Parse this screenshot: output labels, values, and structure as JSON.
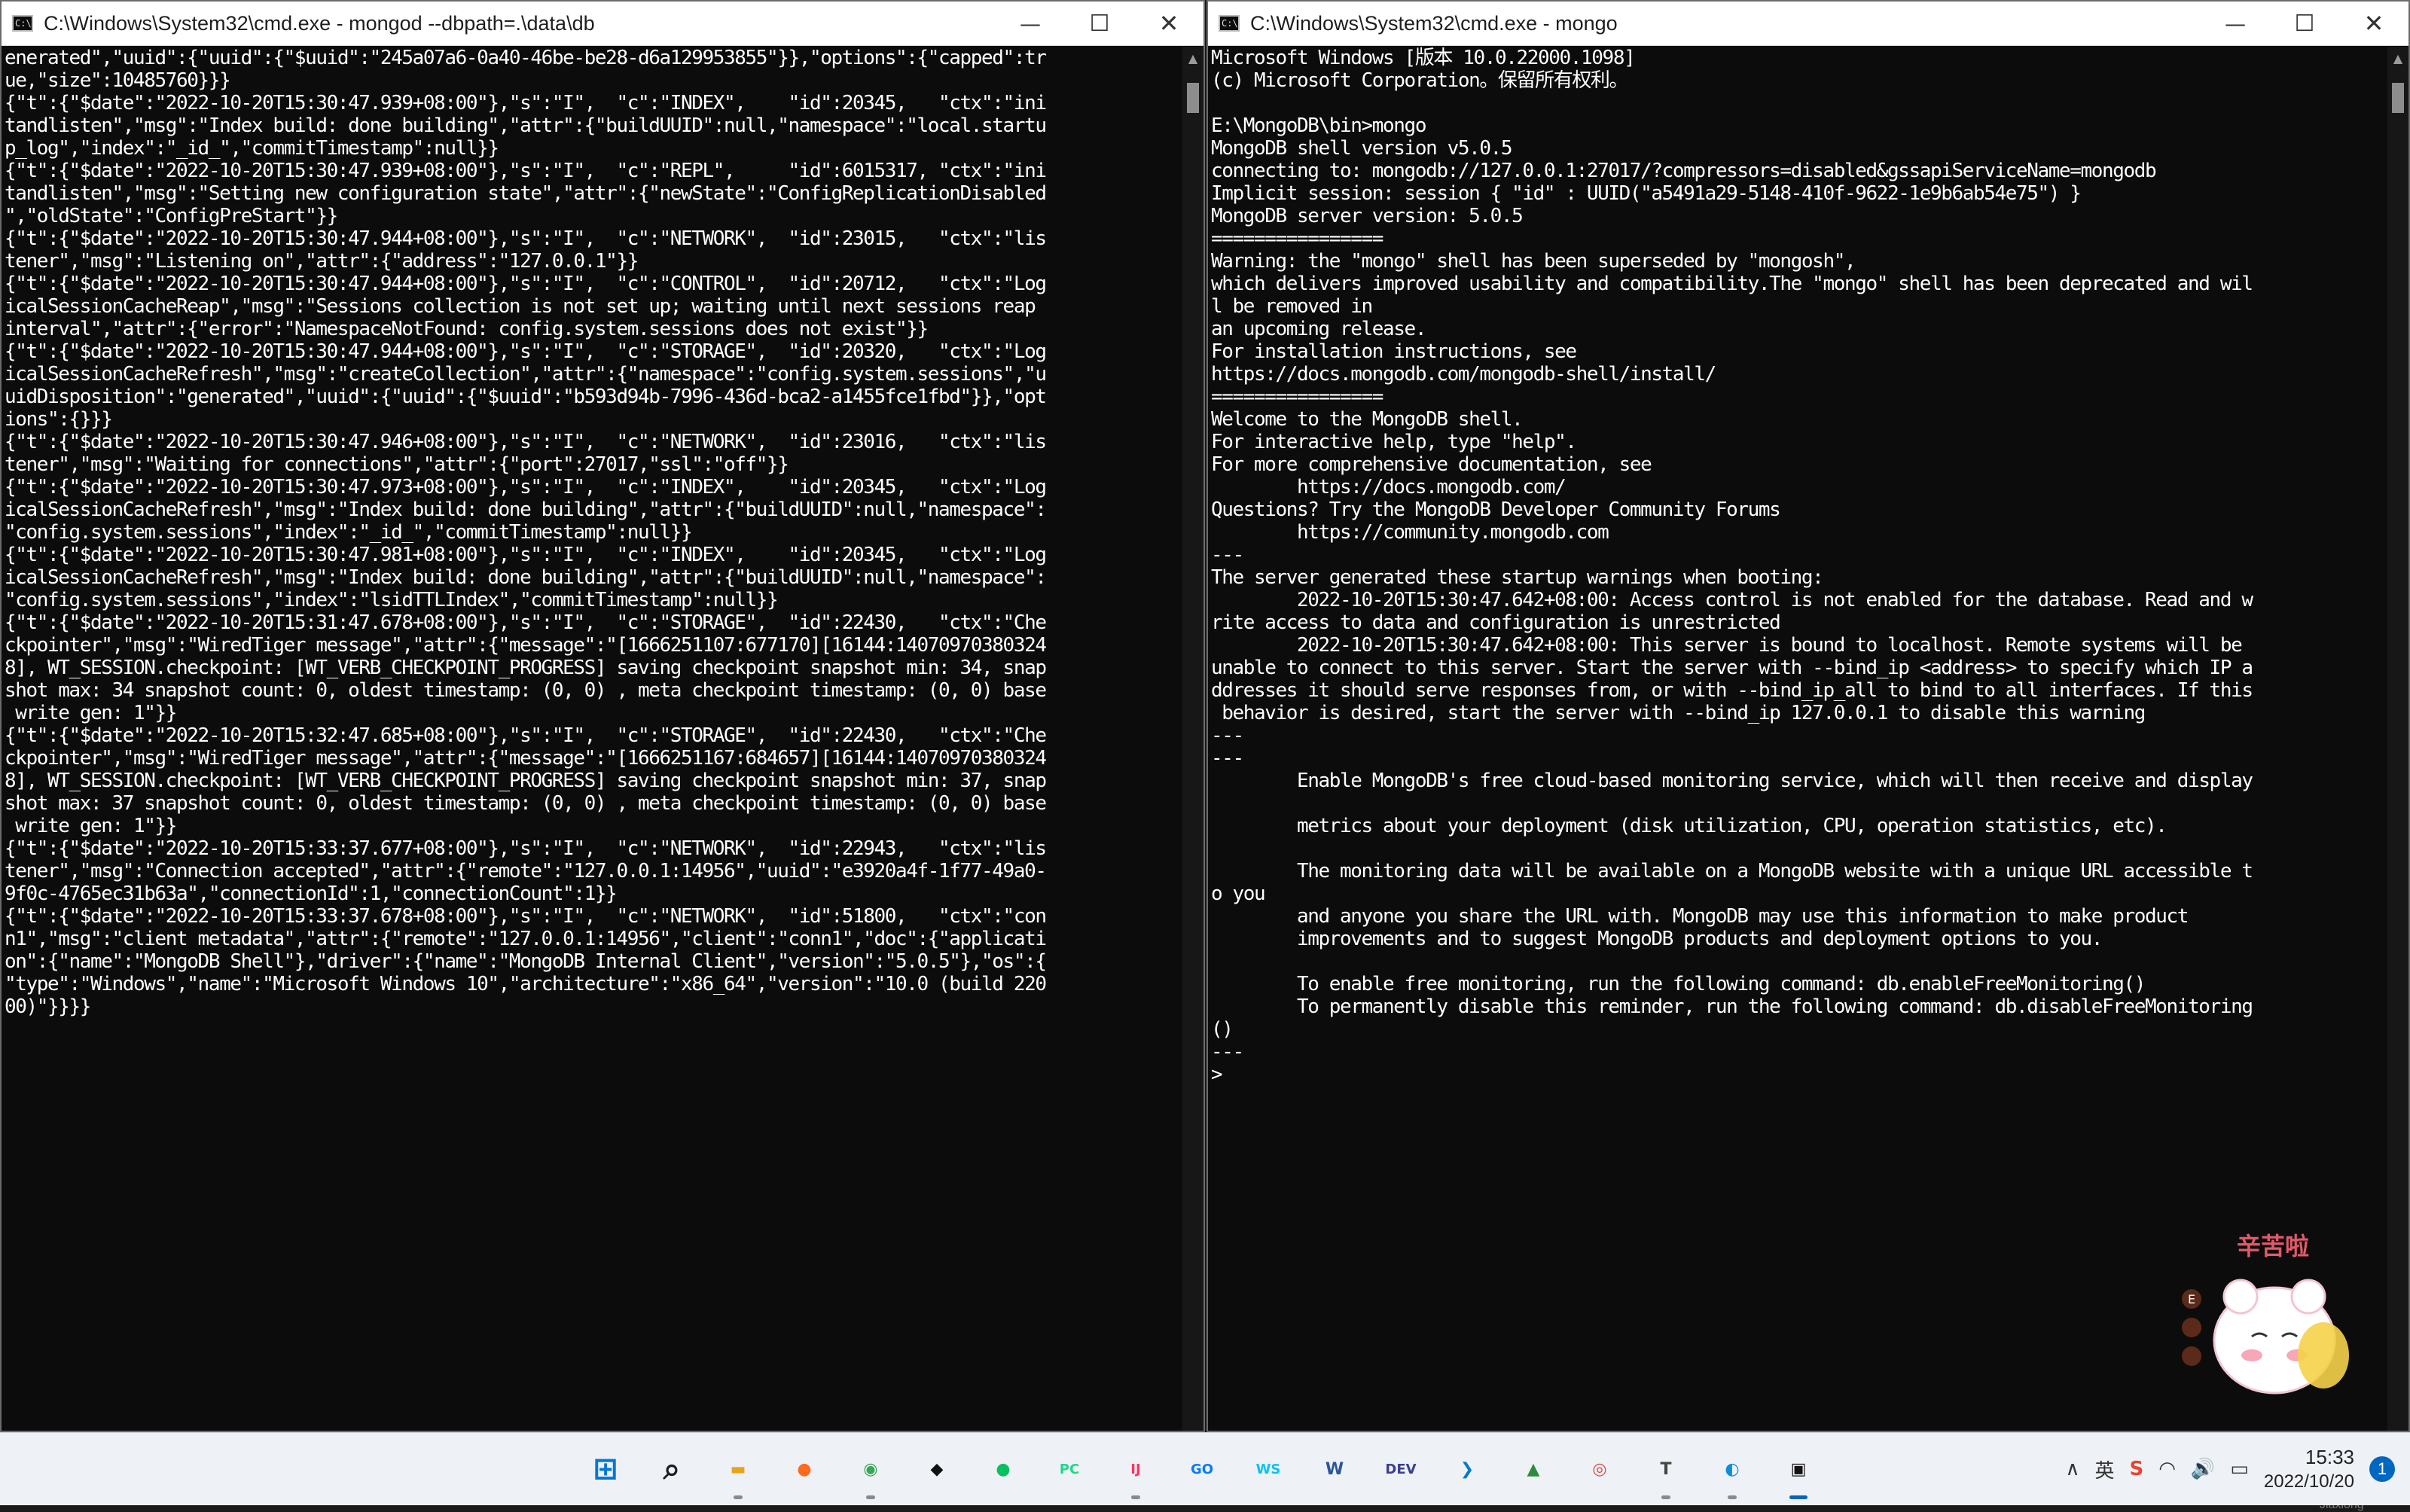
{
  "left_window": {
    "title": "C:\\Windows\\System32\\cmd.exe - mongod  --dbpath=.\\data\\db",
    "icon": "cmd-icon",
    "output": "enerated\",\"uuid\":{\"uuid\":{\"$uuid\":\"245a07a6-0a40-46be-be28-d6a129953855\"}},\"options\":{\"capped\":tr\nue,\"size\":10485760}}}\n{\"t\":{\"$date\":\"2022-10-20T15:30:47.939+08:00\"},\"s\":\"I\",  \"c\":\"INDEX\",    \"id\":20345,   \"ctx\":\"ini\ntandlisten\",\"msg\":\"Index build: done building\",\"attr\":{\"buildUUID\":null,\"namespace\":\"local.startu\np_log\",\"index\":\"_id_\",\"commitTimestamp\":null}}\n{\"t\":{\"$date\":\"2022-10-20T15:30:47.939+08:00\"},\"s\":\"I\",  \"c\":\"REPL\",     \"id\":6015317, \"ctx\":\"ini\ntandlisten\",\"msg\":\"Setting new configuration state\",\"attr\":{\"newState\":\"ConfigReplicationDisabled\n\",\"oldState\":\"ConfigPreStart\"}}\n{\"t\":{\"$date\":\"2022-10-20T15:30:47.944+08:00\"},\"s\":\"I\",  \"c\":\"NETWORK\",  \"id\":23015,   \"ctx\":\"lis\ntener\",\"msg\":\"Listening on\",\"attr\":{\"address\":\"127.0.0.1\"}}\n{\"t\":{\"$date\":\"2022-10-20T15:30:47.944+08:00\"},\"s\":\"I\",  \"c\":\"CONTROL\",  \"id\":20712,   \"ctx\":\"Log\nicalSessionCacheReap\",\"msg\":\"Sessions collection is not set up; waiting until next sessions reap\ninterval\",\"attr\":{\"error\":\"NamespaceNotFound: config.system.sessions does not exist\"}}\n{\"t\":{\"$date\":\"2022-10-20T15:30:47.944+08:00\"},\"s\":\"I\",  \"c\":\"STORAGE\",  \"id\":20320,   \"ctx\":\"Log\nicalSessionCacheRefresh\",\"msg\":\"createCollection\",\"attr\":{\"namespace\":\"config.system.sessions\",\"u\nuidDisposition\":\"generated\",\"uuid\":{\"uuid\":{\"$uuid\":\"b593d94b-7996-436d-bca2-a1455fce1fbd\"}},\"opt\nions\":{}}}\n{\"t\":{\"$date\":\"2022-10-20T15:30:47.946+08:00\"},\"s\":\"I\",  \"c\":\"NETWORK\",  \"id\":23016,   \"ctx\":\"lis\ntener\",\"msg\":\"Waiting for connections\",\"attr\":{\"port\":27017,\"ssl\":\"off\"}}\n{\"t\":{\"$date\":\"2022-10-20T15:30:47.973+08:00\"},\"s\":\"I\",  \"c\":\"INDEX\",    \"id\":20345,   \"ctx\":\"Log\nicalSessionCacheRefresh\",\"msg\":\"Index build: done building\",\"attr\":{\"buildUUID\":null,\"namespace\":\n\"config.system.sessions\",\"index\":\"_id_\",\"commitTimestamp\":null}}\n{\"t\":{\"$date\":\"2022-10-20T15:30:47.981+08:00\"},\"s\":\"I\",  \"c\":\"INDEX\",    \"id\":20345,   \"ctx\":\"Log\nicalSessionCacheRefresh\",\"msg\":\"Index build: done building\",\"attr\":{\"buildUUID\":null,\"namespace\":\n\"config.system.sessions\",\"index\":\"lsidTTLIndex\",\"commitTimestamp\":null}}\n{\"t\":{\"$date\":\"2022-10-20T15:31:47.678+08:00\"},\"s\":\"I\",  \"c\":\"STORAGE\",  \"id\":22430,   \"ctx\":\"Che\nckpointer\",\"msg\":\"WiredTiger message\",\"attr\":{\"message\":\"[1666251107:677170][16144:14070970380324\n8], WT_SESSION.checkpoint: [WT_VERB_CHECKPOINT_PROGRESS] saving checkpoint snapshot min: 34, snap\nshot max: 34 snapshot count: 0, oldest timestamp: (0, 0) , meta checkpoint timestamp: (0, 0) base\n write gen: 1\"}}\n{\"t\":{\"$date\":\"2022-10-20T15:32:47.685+08:00\"},\"s\":\"I\",  \"c\":\"STORAGE\",  \"id\":22430,   \"ctx\":\"Che\nckpointer\",\"msg\":\"WiredTiger message\",\"attr\":{\"message\":\"[1666251167:684657][16144:14070970380324\n8], WT_SESSION.checkpoint: [WT_VERB_CHECKPOINT_PROGRESS] saving checkpoint snapshot min: 37, snap\nshot max: 37 snapshot count: 0, oldest timestamp: (0, 0) , meta checkpoint timestamp: (0, 0) base\n write gen: 1\"}}\n{\"t\":{\"$date\":\"2022-10-20T15:33:37.677+08:00\"},\"s\":\"I\",  \"c\":\"NETWORK\",  \"id\":22943,   \"ctx\":\"lis\ntener\",\"msg\":\"Connection accepted\",\"attr\":{\"remote\":\"127.0.0.1:14956\",\"uuid\":\"e3920a4f-1f77-49a0-\n9f0c-4765ec31b63a\",\"connectionId\":1,\"connectionCount\":1}}\n{\"t\":{\"$date\":\"2022-10-20T15:33:37.678+08:00\"},\"s\":\"I\",  \"c\":\"NETWORK\",  \"id\":51800,   \"ctx\":\"con\nn1\",\"msg\":\"client metadata\",\"attr\":{\"remote\":\"127.0.0.1:14956\",\"client\":\"conn1\",\"doc\":{\"applicati\non\":{\"name\":\"MongoDB Shell\"},\"driver\":{\"name\":\"MongoDB Internal Client\",\"version\":\"5.0.5\"},\"os\":{\n\"type\":\"Windows\",\"name\":\"Microsoft Windows 10\",\"architecture\":\"x86_64\",\"version\":\"10.0 (build 220\n00)\"}}}}"
  },
  "right_window": {
    "title": "C:\\Windows\\System32\\cmd.exe - mongo",
    "icon": "cmd-icon",
    "output": "Microsoft Windows [版本 10.0.22000.1098]\n(c) Microsoft Corporation。保留所有权利。\n\nE:\\MongoDB\\bin>mongo\nMongoDB shell version v5.0.5\nconnecting to: mongodb://127.0.0.1:27017/?compressors=disabled&gssapiServiceName=mongodb\nImplicit session: session { \"id\" : UUID(\"a5491a29-5148-410f-9622-1e9b6ab54e75\") }\nMongoDB server version: 5.0.5\n================\nWarning: the \"mongo\" shell has been superseded by \"mongosh\",\nwhich delivers improved usability and compatibility.The \"mongo\" shell has been deprecated and wil\nl be removed in\nan upcoming release.\nFor installation instructions, see\nhttps://docs.mongodb.com/mongodb-shell/install/\n================\nWelcome to the MongoDB shell.\nFor interactive help, type \"help\".\nFor more comprehensive documentation, see\n        https://docs.mongodb.com/\nQuestions? Try the MongoDB Developer Community Forums\n        https://community.mongodb.com\n---\nThe server generated these startup warnings when booting:\n        2022-10-20T15:30:47.642+08:00: Access control is not enabled for the database. Read and w\nrite access to data and configuration is unrestricted\n        2022-10-20T15:30:47.642+08:00: This server is bound to localhost. Remote systems will be\nunable to connect to this server. Start the server with --bind_ip <address> to specify which IP a\nddresses it should serve responses from, or with --bind_ip_all to bind to all interfaces. If this\n behavior is desired, start the server with --bind_ip 127.0.0.1 to disable this warning\n---\n---\n        Enable MongoDB's free cloud-based monitoring service, which will then receive and display\n\n        metrics about your deployment (disk utilization, CPU, operation statistics, etc).\n\n        The monitoring data will be available on a MongoDB website with a unique URL accessible t\no you\n        and anyone you share the URL with. MongoDB may use this information to make product\n        improvements and to suggest MongoDB products and deployment options to you.\n\n        To enable free monitoring, run the following command: db.enableFreeMonitoring()\n        To permanently disable this reminder, run the following command: db.disableFreeMonitoring\n()\n---\n>"
  },
  "window_controls": {
    "minimize": "—",
    "maximize": "☐",
    "close": "✕"
  },
  "sticker": {
    "text": "辛苦啦"
  },
  "watermark": "CSDN @Qiang Jiaxiong",
  "taskbar": {
    "apps": [
      {
        "name": "start-button",
        "glyph": "⊞",
        "color": "#0078d4",
        "active": false,
        "running": false
      },
      {
        "name": "search-button",
        "glyph": "⌕",
        "color": "#1e1e1e",
        "active": false,
        "running": false
      },
      {
        "name": "file-explorer-app",
        "glyph": "▬",
        "color": "#e8a317",
        "active": false,
        "running": true
      },
      {
        "name": "firefox-app",
        "glyph": "●",
        "color": "#ff6a1f",
        "active": false,
        "running": false
      },
      {
        "name": "chrome-app",
        "glyph": "◉",
        "color": "#34a853",
        "active": false,
        "running": true
      },
      {
        "name": "qq-app",
        "glyph": "◆",
        "color": "#111111",
        "active": false,
        "running": false
      },
      {
        "name": "wechat-app",
        "glyph": "●",
        "color": "#07c160",
        "active": false,
        "running": false
      },
      {
        "name": "pycharm-app",
        "glyph": "PC",
        "color": "#21d789",
        "active": false,
        "running": false
      },
      {
        "name": "intellij-app",
        "glyph": "IJ",
        "color": "#fe315d",
        "active": false,
        "running": true
      },
      {
        "name": "goland-app",
        "glyph": "GO",
        "color": "#087cfa",
        "active": false,
        "running": false
      },
      {
        "name": "webstorm-app",
        "glyph": "WS",
        "color": "#07c3f2",
        "active": false,
        "running": false
      },
      {
        "name": "word-app",
        "glyph": "W",
        "color": "#2b579a",
        "active": false,
        "running": false
      },
      {
        "name": "devecostudio-app",
        "glyph": "DEV",
        "color": "#3b3f8f",
        "active": false,
        "running": false
      },
      {
        "name": "vscode-app",
        "glyph": "❯",
        "color": "#007acc",
        "active": false,
        "running": false
      },
      {
        "name": "image-viewer-app",
        "glyph": "▲",
        "color": "#2e8b3e",
        "active": false,
        "running": false
      },
      {
        "name": "snail-app",
        "glyph": "◎",
        "color": "#d94b3f",
        "active": false,
        "running": false
      },
      {
        "name": "typora-app",
        "glyph": "T",
        "color": "#444444",
        "active": false,
        "running": true
      },
      {
        "name": "edge-app",
        "glyph": "◐",
        "color": "#0c8fd8",
        "active": false,
        "running": true
      },
      {
        "name": "terminal-app",
        "glyph": "▣",
        "color": "#111111",
        "active": true,
        "running": true
      }
    ],
    "tray": {
      "chevron": "∧",
      "ime": "英",
      "ime_icon": "S",
      "wifi": "◠",
      "volume": "🔊",
      "power": "▭",
      "time": "15:33",
      "date": "2022/10/20",
      "notification_count": "1"
    }
  }
}
